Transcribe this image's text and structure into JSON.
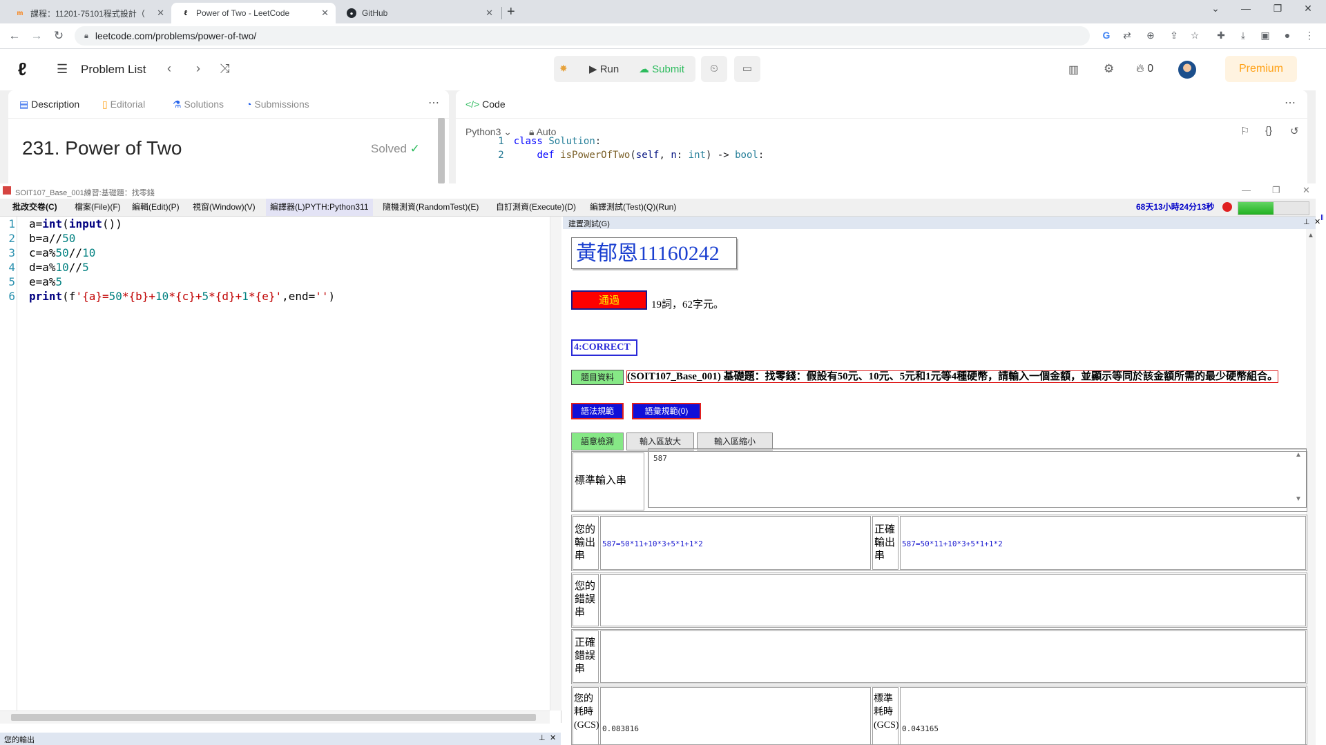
{
  "browser": {
    "tabs": [
      {
        "label": "課程：11201-75101程式設計（",
        "icon": "moodle-icon",
        "active": false
      },
      {
        "label": "Power of Two - LeetCode",
        "icon": "leetcode-icon",
        "active": true
      },
      {
        "label": "GitHub",
        "icon": "github-icon",
        "active": false
      }
    ],
    "url": "leetcode.com/problems/power-of-two/"
  },
  "leetcode": {
    "problem_list_label": "Problem List",
    "run_label": "Run",
    "submit_label": "Submit",
    "streak_count": "0",
    "premium_label": "Premium",
    "desc_tabs": [
      "Description",
      "Editorial",
      "Solutions",
      "Submissions"
    ],
    "problem_title": "231. Power of Two",
    "solved_label": "Solved",
    "code_tab_label": "Code",
    "language": "Python3",
    "mode": "Auto",
    "code_lines": [
      {
        "num": "1",
        "text": "class Solution:"
      },
      {
        "num": "2",
        "text": "def isPowerOfTwo(self, n: int) -> bool:"
      }
    ]
  },
  "app": {
    "title": "SOIT107_Base_001練習:基礎題：找零錢",
    "menu": [
      "批改交卷(C)",
      "檔案(File)(F)",
      "編輯(Edit)(P)",
      "視窗(Window)(V)",
      "編譯器(L)PYTH:Python311",
      "隨機測資(RandomTest)(E)",
      "自訂測資(Execute)(D)",
      "編譯測試(Test)(Q)(Run)"
    ],
    "timer": "68天13小時24分13秒",
    "progress": 0.5,
    "editor_line_numbers": [
      "1",
      "2",
      "3",
      "4",
      "5",
      "6"
    ],
    "code": [
      "a=int(input())",
      "b=a//50",
      "c=a%50//10",
      "d=a%10//5",
      "e=a%5",
      "print(f'{a}=50*{b}+10*{c}+5*{d}+1*{e}',end='')"
    ],
    "output_panel_label": "您的輸出",
    "test_panel_label": "建置測試(G)",
    "student": "黃郁恩11160242",
    "pass_label": "通過",
    "stats": "19詞，62字元。",
    "result": "4:CORRECT",
    "info_button": "題目資料",
    "problem_text": "(SOIT107_Base_001) 基礎題：找零錢：假設有50元、10元、5元和1元等4種硬幣，請輸入一個金額，並顯示等同於該金額所需的最少硬幣組合。",
    "syntax_button": "語法規範",
    "vocab_button": "語彙規範(0)",
    "semantic_button": "語意檢測",
    "enlarge_button": "輸入區放大",
    "shrink_button": "輸入區縮小",
    "stdin_label": "標準輸入串",
    "stdin_value": "587",
    "your_output_label": "您的輸出串",
    "your_output_value": "587=50*11+10*3+5*1+1*2",
    "correct_output_label": "正確輸出串",
    "correct_output_value": "587=50*11+10*3+5*1+1*2",
    "your_error_label": "您的錯誤串",
    "correct_error_label": "正確錯誤串",
    "your_time_label": "您的耗時(GCS)",
    "your_time_value": "0.083816",
    "std_time_label": "標準耗時(GCS)",
    "std_time_value": "0.043165"
  }
}
